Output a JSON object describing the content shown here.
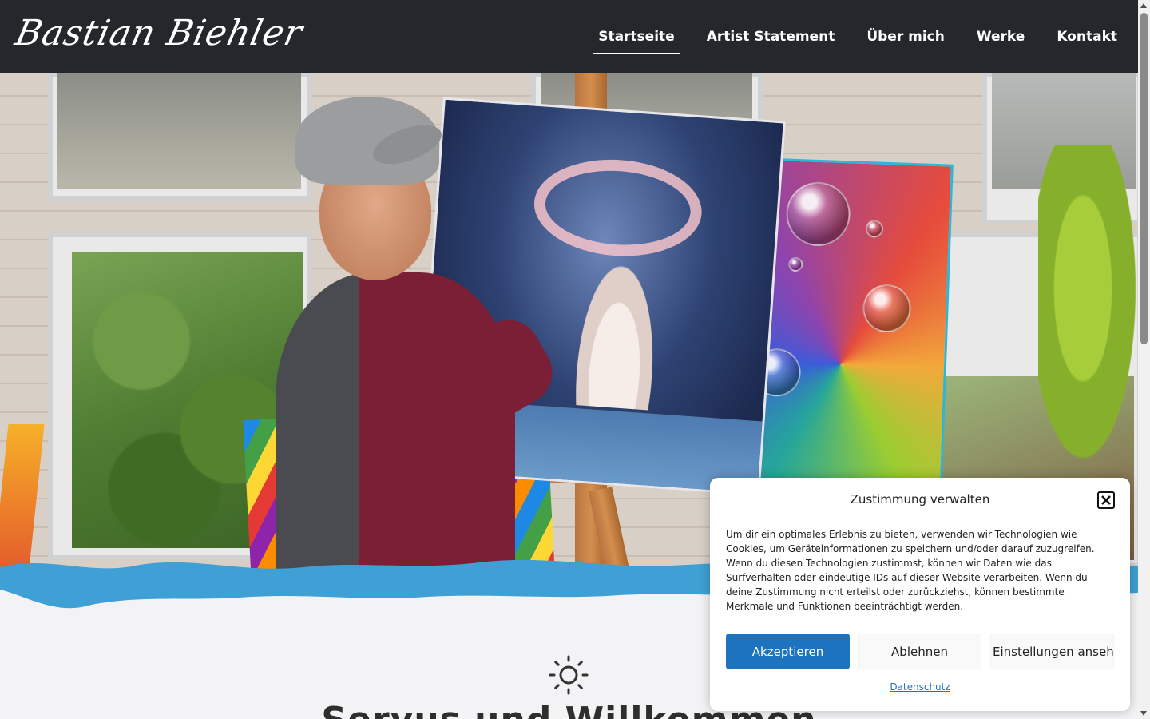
{
  "header": {
    "logo_text": "Bastian Biehler",
    "nav": [
      {
        "label": "Startseite",
        "active": true
      },
      {
        "label": "Artist Statement",
        "active": false
      },
      {
        "label": "Über mich",
        "active": false
      },
      {
        "label": "Werke",
        "active": false
      },
      {
        "label": "Kontakt",
        "active": false
      }
    ]
  },
  "intro": {
    "icon": "sun-icon",
    "title": "Servus und Willkommen"
  },
  "consent": {
    "title": "Zustimmung verwalten",
    "body": "Um dir ein optimales Erlebnis zu bieten, verwenden wir Technologien wie Cookies, um Geräteinformationen zu speichern und/oder darauf zuzugreifen. Wenn du diesen Technologien zustimmst, können wir Daten wie das Surfverhalten oder eindeutige IDs auf dieser Website verarbeiten. Wenn du deine Zustimmung nicht erteilst oder zurückziehst, können bestimmte Merkmale und Funktionen beeinträchtigt werden.",
    "accept_label": "Akzeptieren",
    "deny_label": "Ablehnen",
    "settings_label": "Einstellungen ansehen",
    "privacy_link": "Datenschutz",
    "close_icon": "close-icon"
  },
  "colors": {
    "header_bg": "#24272b",
    "accent_blue": "#1e73be",
    "wave_blue": "#3ea0d4",
    "page_bg": "#f3f2f4"
  }
}
